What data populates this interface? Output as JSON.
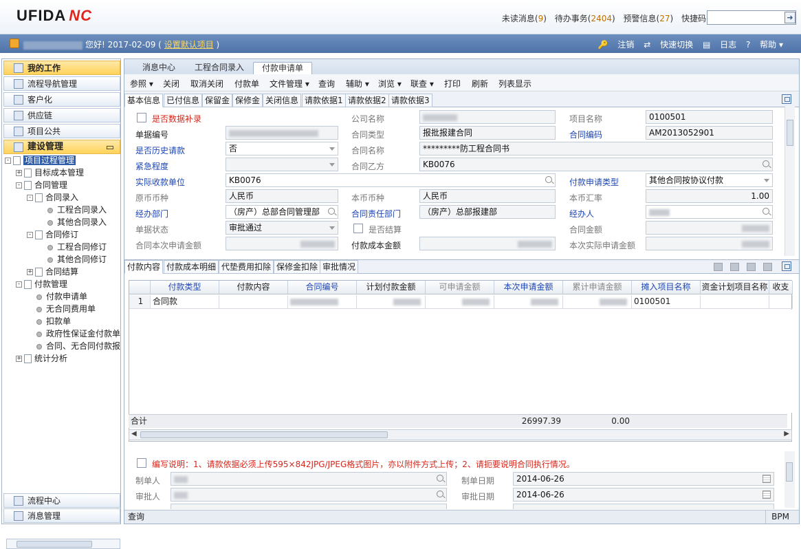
{
  "header": {
    "logo_text": "UFIDA",
    "logo_nc": "NC",
    "unread_label": "未读消息(",
    "unread_count": "9",
    "todo_label": "待办事务(",
    "todo_count": "2404",
    "alert_label": "预警信息(",
    "alert_count": "27",
    "close_paren": ")",
    "quickcode_label": "快捷码",
    "quickcode_value": ""
  },
  "userbar": {
    "greeting": "您好! 2017-02-09 ( ",
    "set_default_link": "设置默认项目",
    "greeting_end": " )",
    "logout": "注销",
    "quick_switch": "快速切换",
    "log": "日志",
    "help": "帮助"
  },
  "leftnav": {
    "heads": [
      "我的工作",
      "流程导航管理",
      "客户化",
      "供应链",
      "项目公共",
      "建设管理"
    ],
    "bottom_heads": [
      "流程中心",
      "消息管理"
    ],
    "tree": [
      {
        "label": "项目过程管理",
        "level": 0,
        "kind": "doc",
        "exp": "-"
      },
      {
        "label": "目标成本管理",
        "level": 1,
        "kind": "doc",
        "exp": "+"
      },
      {
        "label": "合同管理",
        "level": 1,
        "kind": "doc",
        "exp": "-"
      },
      {
        "label": "合同录入",
        "level": 2,
        "kind": "doc",
        "exp": "-"
      },
      {
        "label": "工程合同录入",
        "level": 3,
        "kind": "dot"
      },
      {
        "label": "其他合同录入",
        "level": 3,
        "kind": "dot"
      },
      {
        "label": "合同修订",
        "level": 2,
        "kind": "doc",
        "exp": "-"
      },
      {
        "label": "工程合同修订",
        "level": 3,
        "kind": "dot"
      },
      {
        "label": "其他合同修订",
        "level": 3,
        "kind": "dot"
      },
      {
        "label": "合同结算",
        "level": 2,
        "kind": "doc",
        "exp": "+"
      },
      {
        "label": "付款管理",
        "level": 1,
        "kind": "doc",
        "exp": "-"
      },
      {
        "label": "付款申请单",
        "level": 2,
        "kind": "dot"
      },
      {
        "label": "无合同费用单",
        "level": 2,
        "kind": "dot"
      },
      {
        "label": "扣款单",
        "level": 2,
        "kind": "dot"
      },
      {
        "label": "政府性保证金付款单",
        "level": 2,
        "kind": "dot"
      },
      {
        "label": "合同、无合同付款报",
        "level": 2,
        "kind": "dot"
      },
      {
        "label": "统计分析",
        "level": 1,
        "kind": "doc",
        "exp": "+"
      }
    ]
  },
  "main": {
    "tabs": [
      "消息中心",
      "工程合同录入",
      "付款申请单"
    ],
    "menu": [
      "参照",
      "关闭",
      "取消关闭",
      "付款单",
      "文件管理",
      "查询",
      "辅助",
      "浏览",
      "联查",
      "打印",
      "刷新",
      "列表显示"
    ],
    "subtabs": [
      "基本信息",
      "已付信息",
      "保留金",
      "保修金",
      "关闭信息",
      "请款依据1",
      "请款依据2",
      "请款依据3"
    ],
    "form": {
      "is_supplement": "是否数据补录",
      "company_name": "公司名称",
      "project_name": "项目名称",
      "project_name_value": "0100501",
      "doc_no": "单据编号",
      "contract_type": "合同类型",
      "contract_type_value": "报批报建合同",
      "contract_code": "合同编码",
      "contract_code_value": "AM2013052901",
      "is_history": "是否历史请款",
      "is_history_value": "否",
      "contract_name": "合同名称",
      "contract_name_value": "*********防工程合同书",
      "urgency": "紧急程度",
      "party_b": "合同乙方",
      "party_b_value": "KB0076",
      "actual_payee": "实际收款单位",
      "actual_payee_value": "KB0076",
      "pay_apply_type": "付款申请类型",
      "pay_apply_type_value": "其他合同按协议付款",
      "orig_currency": "原币币种",
      "orig_currency_value": "人民币",
      "local_currency": "本币币种",
      "local_currency_value": "人民币",
      "local_rate": "本币汇率",
      "local_rate_value": "1.00",
      "handler_dept": "经办部门",
      "handler_dept_value": "（房产）总部合同管理部",
      "contract_dept": "合同责任部门",
      "contract_dept_value": "（房产）总部报建部",
      "handler": "经办人",
      "doc_status": "单据状态",
      "doc_status_value": "审批通过",
      "is_settled": "是否结算",
      "contract_amount": "合同金额",
      "apply_amount": "合同本次申请金额",
      "cost_amount": "付款成本金额",
      "actual_apply_amount": "本次实际申请金额"
    },
    "subtabs2": [
      "付款内容",
      "付款成本明细",
      "代垫费用扣除",
      "保修金扣除",
      "审批情况"
    ],
    "grid": {
      "headers": [
        "付款类型",
        "付款内容",
        "合同编号",
        "计划付款金额",
        "可申请金额",
        "本次申请金额",
        "累计申请金额",
        "摊入项目名称",
        "资金计划项目名称",
        "收支"
      ],
      "rows": [
        {
          "no": "1",
          "type": "合同款",
          "project": "0100501"
        }
      ],
      "sum_label": "合计",
      "sum_current": "26997.39",
      "sum_cumulative": "0.00"
    },
    "footer": {
      "note": "编写说明：1、请款依据必须上传595×842JPG/JPEG格式图片，亦以附件方式上传；2、请扼要说明合同执行情况。",
      "maker": "制单人",
      "make_date": "制单日期",
      "make_date_value": "2014-06-26",
      "approver": "审批人",
      "approve_date": "审批日期",
      "approve_date_value": "2014-06-26"
    },
    "status_left": "查询",
    "status_right": "BPM"
  },
  "colors": {
    "accent": "#4f74a8",
    "active_nav": "#ffd35a",
    "label_blue": "#1e46b4",
    "label_red": "#d7261b"
  }
}
